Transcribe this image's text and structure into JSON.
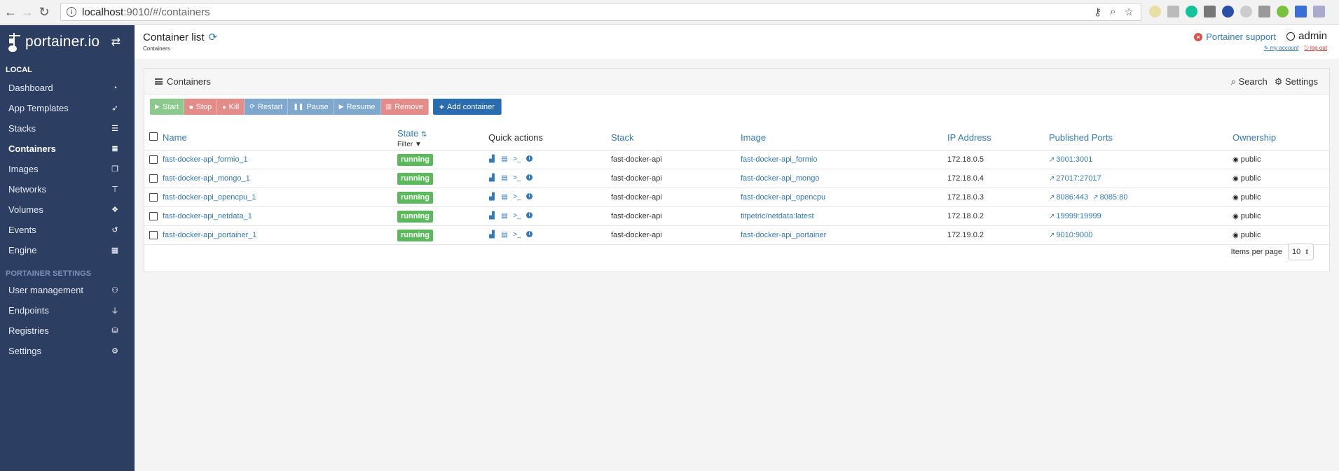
{
  "browser": {
    "url_host": "localhost",
    "url_rest": ":9010/#/containers"
  },
  "sidebar": {
    "brand": "portainer.io",
    "section_local": "LOCAL",
    "items": [
      {
        "label": "Dashboard",
        "icon": "tachometer-icon"
      },
      {
        "label": "App Templates",
        "icon": "rocket-icon"
      },
      {
        "label": "Stacks",
        "icon": "th-list-icon"
      },
      {
        "label": "Containers",
        "icon": "server-icon",
        "active": true
      },
      {
        "label": "Images",
        "icon": "clone-icon"
      },
      {
        "label": "Networks",
        "icon": "sitemap-icon"
      },
      {
        "label": "Volumes",
        "icon": "cubes-icon"
      },
      {
        "label": "Events",
        "icon": "history-icon"
      },
      {
        "label": "Engine",
        "icon": "th-icon"
      }
    ],
    "section_settings": "PORTAINER SETTINGS",
    "settings_items": [
      {
        "label": "User management",
        "icon": "users-icon"
      },
      {
        "label": "Endpoints",
        "icon": "plug-icon"
      },
      {
        "label": "Registries",
        "icon": "database-icon"
      },
      {
        "label": "Settings",
        "icon": "cogs-icon"
      }
    ]
  },
  "header": {
    "title": "Container list",
    "breadcrumb": "Containers",
    "support": "Portainer support",
    "user": "admin",
    "my_account": "my account",
    "log_out": "log out"
  },
  "widget": {
    "title": "Containers",
    "search": "Search",
    "settings": "Settings",
    "buttons": {
      "start": "Start",
      "stop": "Stop",
      "kill": "Kill",
      "restart": "Restart",
      "pause": "Pause",
      "resume": "Resume",
      "remove": "Remove",
      "add": "Add container"
    },
    "columns": {
      "name": "Name",
      "state": "State",
      "filter": "Filter",
      "quick_actions": "Quick actions",
      "stack": "Stack",
      "image": "Image",
      "ip": "IP Address",
      "ports": "Published Ports",
      "ownership": "Ownership"
    },
    "rows": [
      {
        "name": "fast-docker-api_formio_1",
        "state": "running",
        "stack": "fast-docker-api",
        "image": "fast-docker-api_formio",
        "ip": "172.18.0.5",
        "ports": [
          "3001:3001"
        ],
        "ownership": "public"
      },
      {
        "name": "fast-docker-api_mongo_1",
        "state": "running",
        "stack": "fast-docker-api",
        "image": "fast-docker-api_mongo",
        "ip": "172.18.0.4",
        "ports": [
          "27017:27017"
        ],
        "ownership": "public"
      },
      {
        "name": "fast-docker-api_opencpu_1",
        "state": "running",
        "stack": "fast-docker-api",
        "image": "fast-docker-api_opencpu",
        "ip": "172.18.0.3",
        "ports": [
          "8086:443",
          "8085:80"
        ],
        "ownership": "public"
      },
      {
        "name": "fast-docker-api_netdata_1",
        "state": "running",
        "stack": "fast-docker-api",
        "image": "titpetric/netdata:latest",
        "ip": "172.18.0.2",
        "ports": [
          "19999:19999"
        ],
        "ownership": "public"
      },
      {
        "name": "fast-docker-api_portainer_1",
        "state": "running",
        "stack": "fast-docker-api",
        "image": "fast-docker-api_portainer",
        "ip": "172.19.0.2",
        "ports": [
          "9010:9000"
        ],
        "ownership": "public"
      }
    ],
    "items_per_page_label": "Items per page",
    "items_per_page": "10"
  },
  "colors": {
    "sidebar_bg": "#2d3e63",
    "link": "#337ab7",
    "running": "#5cb85c"
  }
}
